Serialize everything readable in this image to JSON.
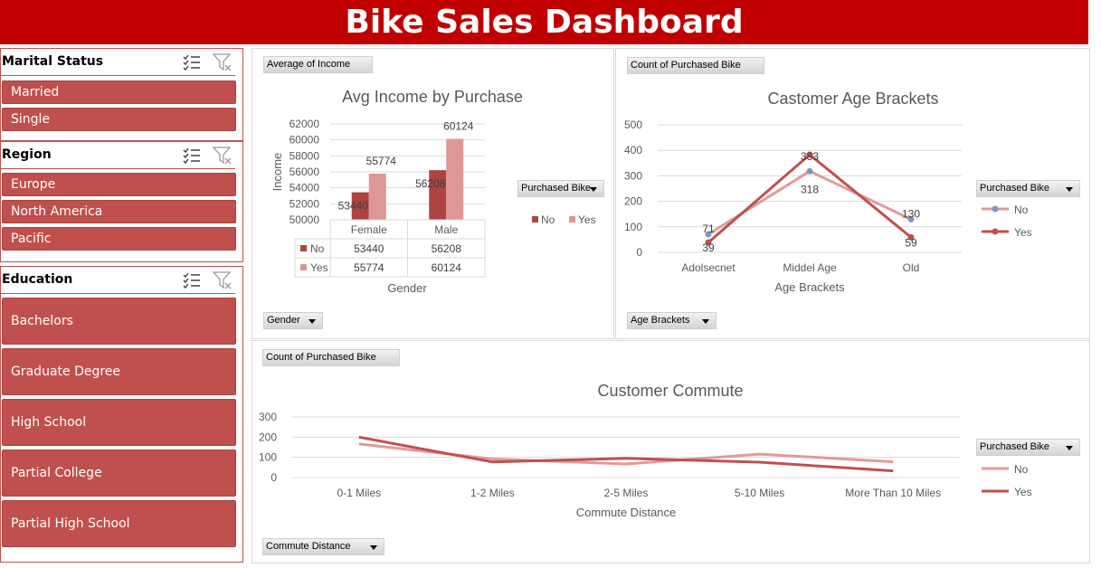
{
  "title": "Bike Sales Dashboard",
  "slicers": [
    {
      "title": "Marital Status",
      "items": [
        "Married",
        "Single"
      ]
    },
    {
      "title": "Region",
      "items": [
        "Europe",
        "North America",
        "Pacific"
      ]
    },
    {
      "title": "Education",
      "items": [
        "Bachelors",
        "Graduate Degree",
        "High School",
        "Partial College",
        "Partial High School"
      ]
    }
  ],
  "panels": {
    "income": {
      "value_button": "Average of Income",
      "axis_button": "Gender",
      "legend_button": "Purchased Bike"
    },
    "age": {
      "value_button": "Count of Purchased Bike",
      "axis_button": "Age Brackets",
      "legend_button": "Purchased Bike"
    },
    "commute": {
      "value_button": "Count of Purchased Bike",
      "axis_button": "Commute Distance",
      "legend_button": "Purchased Bike"
    }
  },
  "colors": {
    "no": "#e09b99",
    "yes": "#c0504d",
    "no_bar": "#b04240",
    "yes_bar": "#dd9795",
    "accent": "#c00000"
  },
  "chart_data": [
    {
      "type": "bar",
      "title": "Avg Income by Purchase",
      "xlabel": "Gender",
      "ylabel": "Income",
      "categories": [
        "Female",
        "Male"
      ],
      "series": [
        {
          "name": "No",
          "values": [
            53440,
            56208
          ]
        },
        {
          "name": "Yes",
          "values": [
            55774,
            60124
          ]
        }
      ],
      "ylim": [
        50000,
        62000
      ],
      "yticks": [
        50000,
        52000,
        54000,
        56000,
        58000,
        60000,
        62000
      ],
      "data_table": true,
      "legend": "right"
    },
    {
      "type": "line",
      "title": "Castomer Age Brackets",
      "xlabel": "Age Brackets",
      "categories": [
        "Adolsecnet",
        "Middel Age",
        "Old"
      ],
      "series": [
        {
          "name": "No",
          "values": [
            71,
            318,
            130
          ]
        },
        {
          "name": "Yes",
          "values": [
            39,
            383,
            59
          ]
        }
      ],
      "ylim": [
        0,
        500
      ],
      "yticks": [
        0,
        100,
        200,
        300,
        400,
        500
      ],
      "legend": "right"
    },
    {
      "type": "line",
      "title": "Customer Commute",
      "xlabel": "Commute Distance",
      "categories": [
        "0-1 Miles",
        "1-2 Miles",
        "2-5 Miles",
        "5-10 Miles",
        "More Than 10 Miles"
      ],
      "series": [
        {
          "name": "No",
          "values": [
            166,
            92,
            67,
            116,
            78
          ]
        },
        {
          "name": "Yes",
          "values": [
            200,
            77,
            95,
            76,
            33
          ]
        }
      ],
      "ylim": [
        0,
        300
      ],
      "yticks": [
        0,
        100,
        200,
        300
      ],
      "legend": "right"
    }
  ]
}
